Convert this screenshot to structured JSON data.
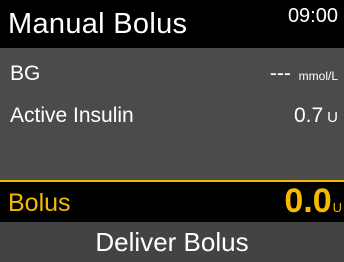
{
  "header": {
    "title": "Manual Bolus",
    "time": "09:00"
  },
  "readings": {
    "bg": {
      "label": "BG",
      "value": "---",
      "unit": "mmol/L"
    },
    "active_insulin": {
      "label": "Active Insulin",
      "value": "0.7",
      "unit": "U"
    }
  },
  "bolus": {
    "label": "Bolus",
    "value": "0.0",
    "unit": "U"
  },
  "actions": {
    "deliver_label": "Deliver Bolus"
  },
  "colors": {
    "accent": "#f7b900",
    "panel": "#4b4b4b",
    "background": "#000000",
    "button": "#434343"
  }
}
